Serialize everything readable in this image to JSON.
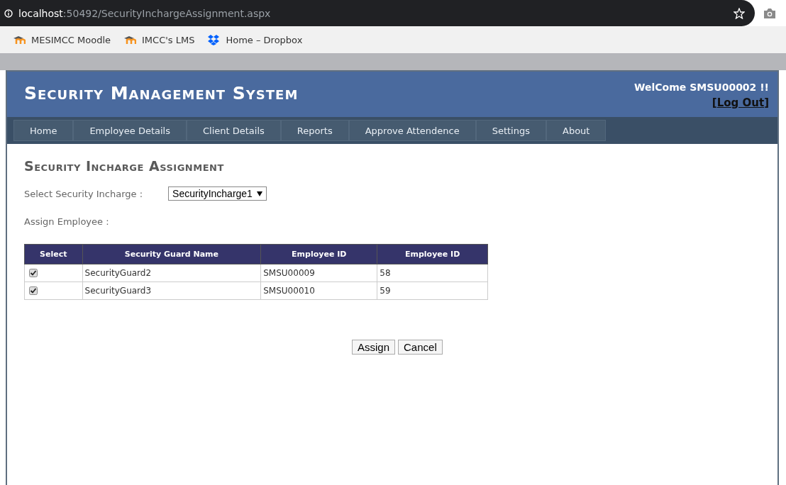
{
  "browser": {
    "url_host": "localhost",
    "url_path": ":50492/SecurityInchargeAssignment.aspx",
    "bookmarks": [
      {
        "label": "MESIMCC Moodle",
        "kind": "moodle"
      },
      {
        "label": "IMCC's LMS",
        "kind": "moodle"
      },
      {
        "label": "Home – Dropbox",
        "kind": "dropbox"
      }
    ]
  },
  "header": {
    "title": "Security Management System",
    "welcome": "WelCome SMSU00002 !!",
    "logout_open": "[",
    "logout": "Log Out",
    "logout_close": "]"
  },
  "nav": [
    {
      "label": "Home"
    },
    {
      "label": "Employee Details"
    },
    {
      "label": "Client Details"
    },
    {
      "label": "Reports"
    },
    {
      "label": "Approve Attendence"
    },
    {
      "label": "Settings"
    },
    {
      "label": "About"
    }
  ],
  "page": {
    "title": "Security Incharge Assignment",
    "select_label": "Select Security Incharge :",
    "select_value": "SecurityIncharge1",
    "assign_label": "Assign Employee :"
  },
  "table": {
    "columns": [
      "Select",
      "Security Guard Name",
      "Employee ID",
      "Employee ID"
    ],
    "rows": [
      {
        "checked": true,
        "cells": [
          "",
          "SecurityGuard2",
          "SMSU00009",
          "58"
        ]
      },
      {
        "checked": true,
        "cells": [
          "",
          "SecurityGuard3",
          "SMSU00010",
          "59"
        ]
      }
    ]
  },
  "buttons": [
    "Assign",
    "Cancel"
  ]
}
